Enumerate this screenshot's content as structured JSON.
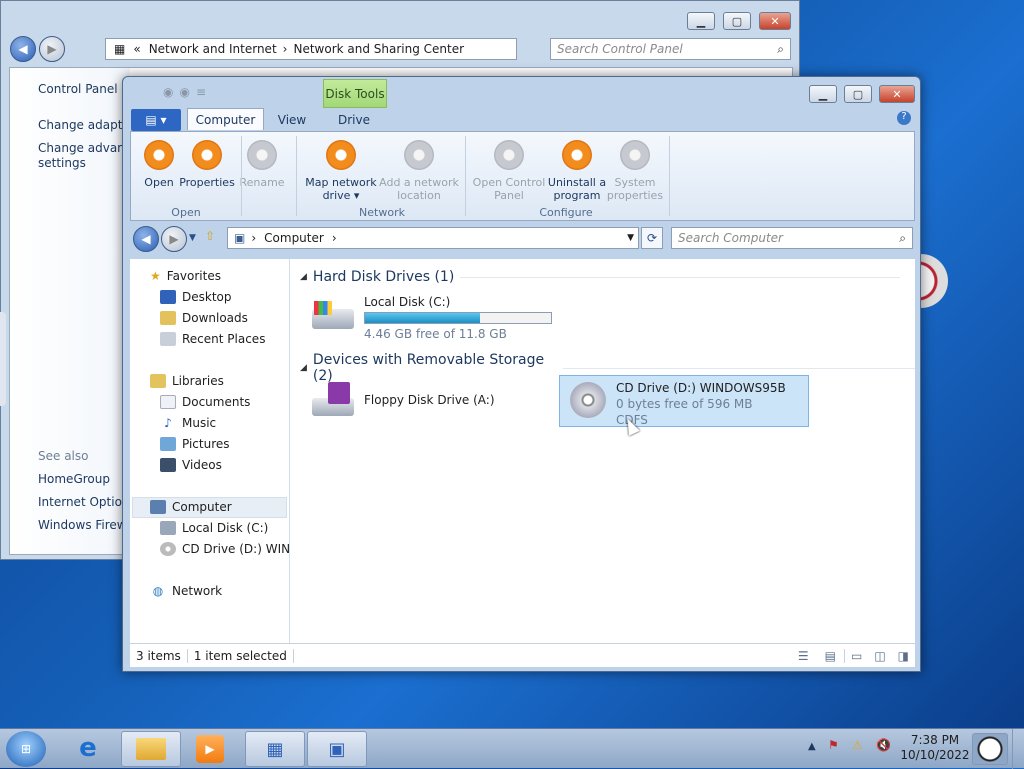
{
  "bg_window": {
    "address": {
      "chevrons": "«",
      "crumbs": [
        "Network and Internet",
        "Network and Sharing Center"
      ]
    },
    "search_placeholder": "Search Control Panel",
    "side_links": [
      "Control Panel H",
      "Change adapter",
      "Change advance",
      "settings"
    ],
    "see_also_title": "See also",
    "see_also": [
      "HomeGroup",
      "Internet Options",
      "Windows Firewa"
    ]
  },
  "window": {
    "contextual_tab_group": "Disk Tools",
    "tabs": [
      "Computer",
      "View",
      "Drive"
    ],
    "ribbon": {
      "open_group": {
        "label": "Open",
        "buttons": [
          "Open",
          "Properties",
          "Rename"
        ]
      },
      "network_group": {
        "label": "Network",
        "buttons": [
          [
            "Map network",
            "drive ▾"
          ],
          [
            "Add a network",
            "location"
          ]
        ]
      },
      "configure_group": {
        "label": "Configure",
        "buttons": [
          [
            "Open Control",
            "Panel"
          ],
          [
            "Uninstall a",
            "program"
          ],
          [
            "System",
            "properties"
          ]
        ]
      }
    },
    "address": {
      "crumb": "Computer"
    },
    "search_placeholder": "Search Computer",
    "nav": {
      "favorites": "Favorites",
      "favorites_items": [
        "Desktop",
        "Downloads",
        "Recent Places"
      ],
      "libraries": "Libraries",
      "libraries_items": [
        "Documents",
        "Music",
        "Pictures",
        "Videos"
      ],
      "computer": "Computer",
      "computer_items": [
        "Local Disk (C:)",
        "CD Drive (D:) WINDC"
      ],
      "network": "Network"
    },
    "groups": [
      {
        "title": "Hard Disk Drives (1)"
      },
      {
        "title": "Devices with Removable Storage (2)"
      }
    ],
    "drives": {
      "c": {
        "name": "Local Disk (C:)",
        "free": "4.46 GB free of 11.8 GB",
        "used_fraction": 0.62
      },
      "a": {
        "name": "Floppy Disk Drive (A:)"
      },
      "d": {
        "name": "CD Drive (D:) WINDOWS95B",
        "free": "0 bytes free of 596 MB",
        "fs": "CDFS"
      }
    },
    "status": {
      "items": "3 items",
      "selected": "1 item selected"
    }
  },
  "taskbar": {
    "time": "7:38 PM",
    "date": "10/10/2022"
  }
}
